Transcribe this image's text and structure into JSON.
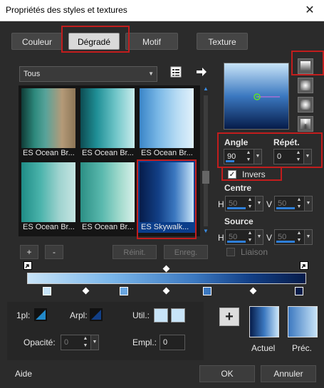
{
  "window": {
    "title": "Propriétés des styles et textures",
    "close_glyph": "✕"
  },
  "tabs": [
    {
      "label": "Couleur"
    },
    {
      "label": "Dégradé"
    },
    {
      "label": "Motif"
    },
    {
      "label": "Texture"
    }
  ],
  "category": {
    "value": "Tous"
  },
  "swatches": [
    {
      "label": "ES Ocean Br..."
    },
    {
      "label": "ES Ocean Br..."
    },
    {
      "label": "ES Ocean Br..."
    },
    {
      "label": "ES Ocean Br..."
    },
    {
      "label": "ES Ocean Br..."
    },
    {
      "label": "ES Skywalk..."
    }
  ],
  "list_buttons": {
    "add": "+",
    "remove": "-",
    "reset": "Réinit.",
    "save": "Enreg."
  },
  "gradient": {
    "angle_label": "Angle",
    "angle": "90",
    "repeat_label": "Répét.",
    "repeat": "0",
    "invert_label": "Invers",
    "invert_checked": true,
    "center_label": "Centre",
    "center_h_label": "H",
    "center_h": "50",
    "center_v_label": "V",
    "center_v": "50",
    "source_label": "Source",
    "source_h_label": "H",
    "source_h": "50",
    "source_v_label": "V",
    "source_v": "50",
    "link_label": "Liaison",
    "colors": {
      "light": "#c8e4f8",
      "mid": "#3b78c0",
      "dark": "#061c4a"
    }
  },
  "bottom": {
    "fg_label": "1pl:",
    "bg_label": "Arpl:",
    "use_label": "Util.:",
    "opacity_label": "Opacité:",
    "opacity": "0",
    "location_label": "Empl.:",
    "location": "0",
    "current_label": "Actuel",
    "previous_label": "Préc.",
    "add_glyph": "+"
  },
  "footer": {
    "help": "Aide",
    "ok": "OK",
    "cancel": "Annuler"
  }
}
